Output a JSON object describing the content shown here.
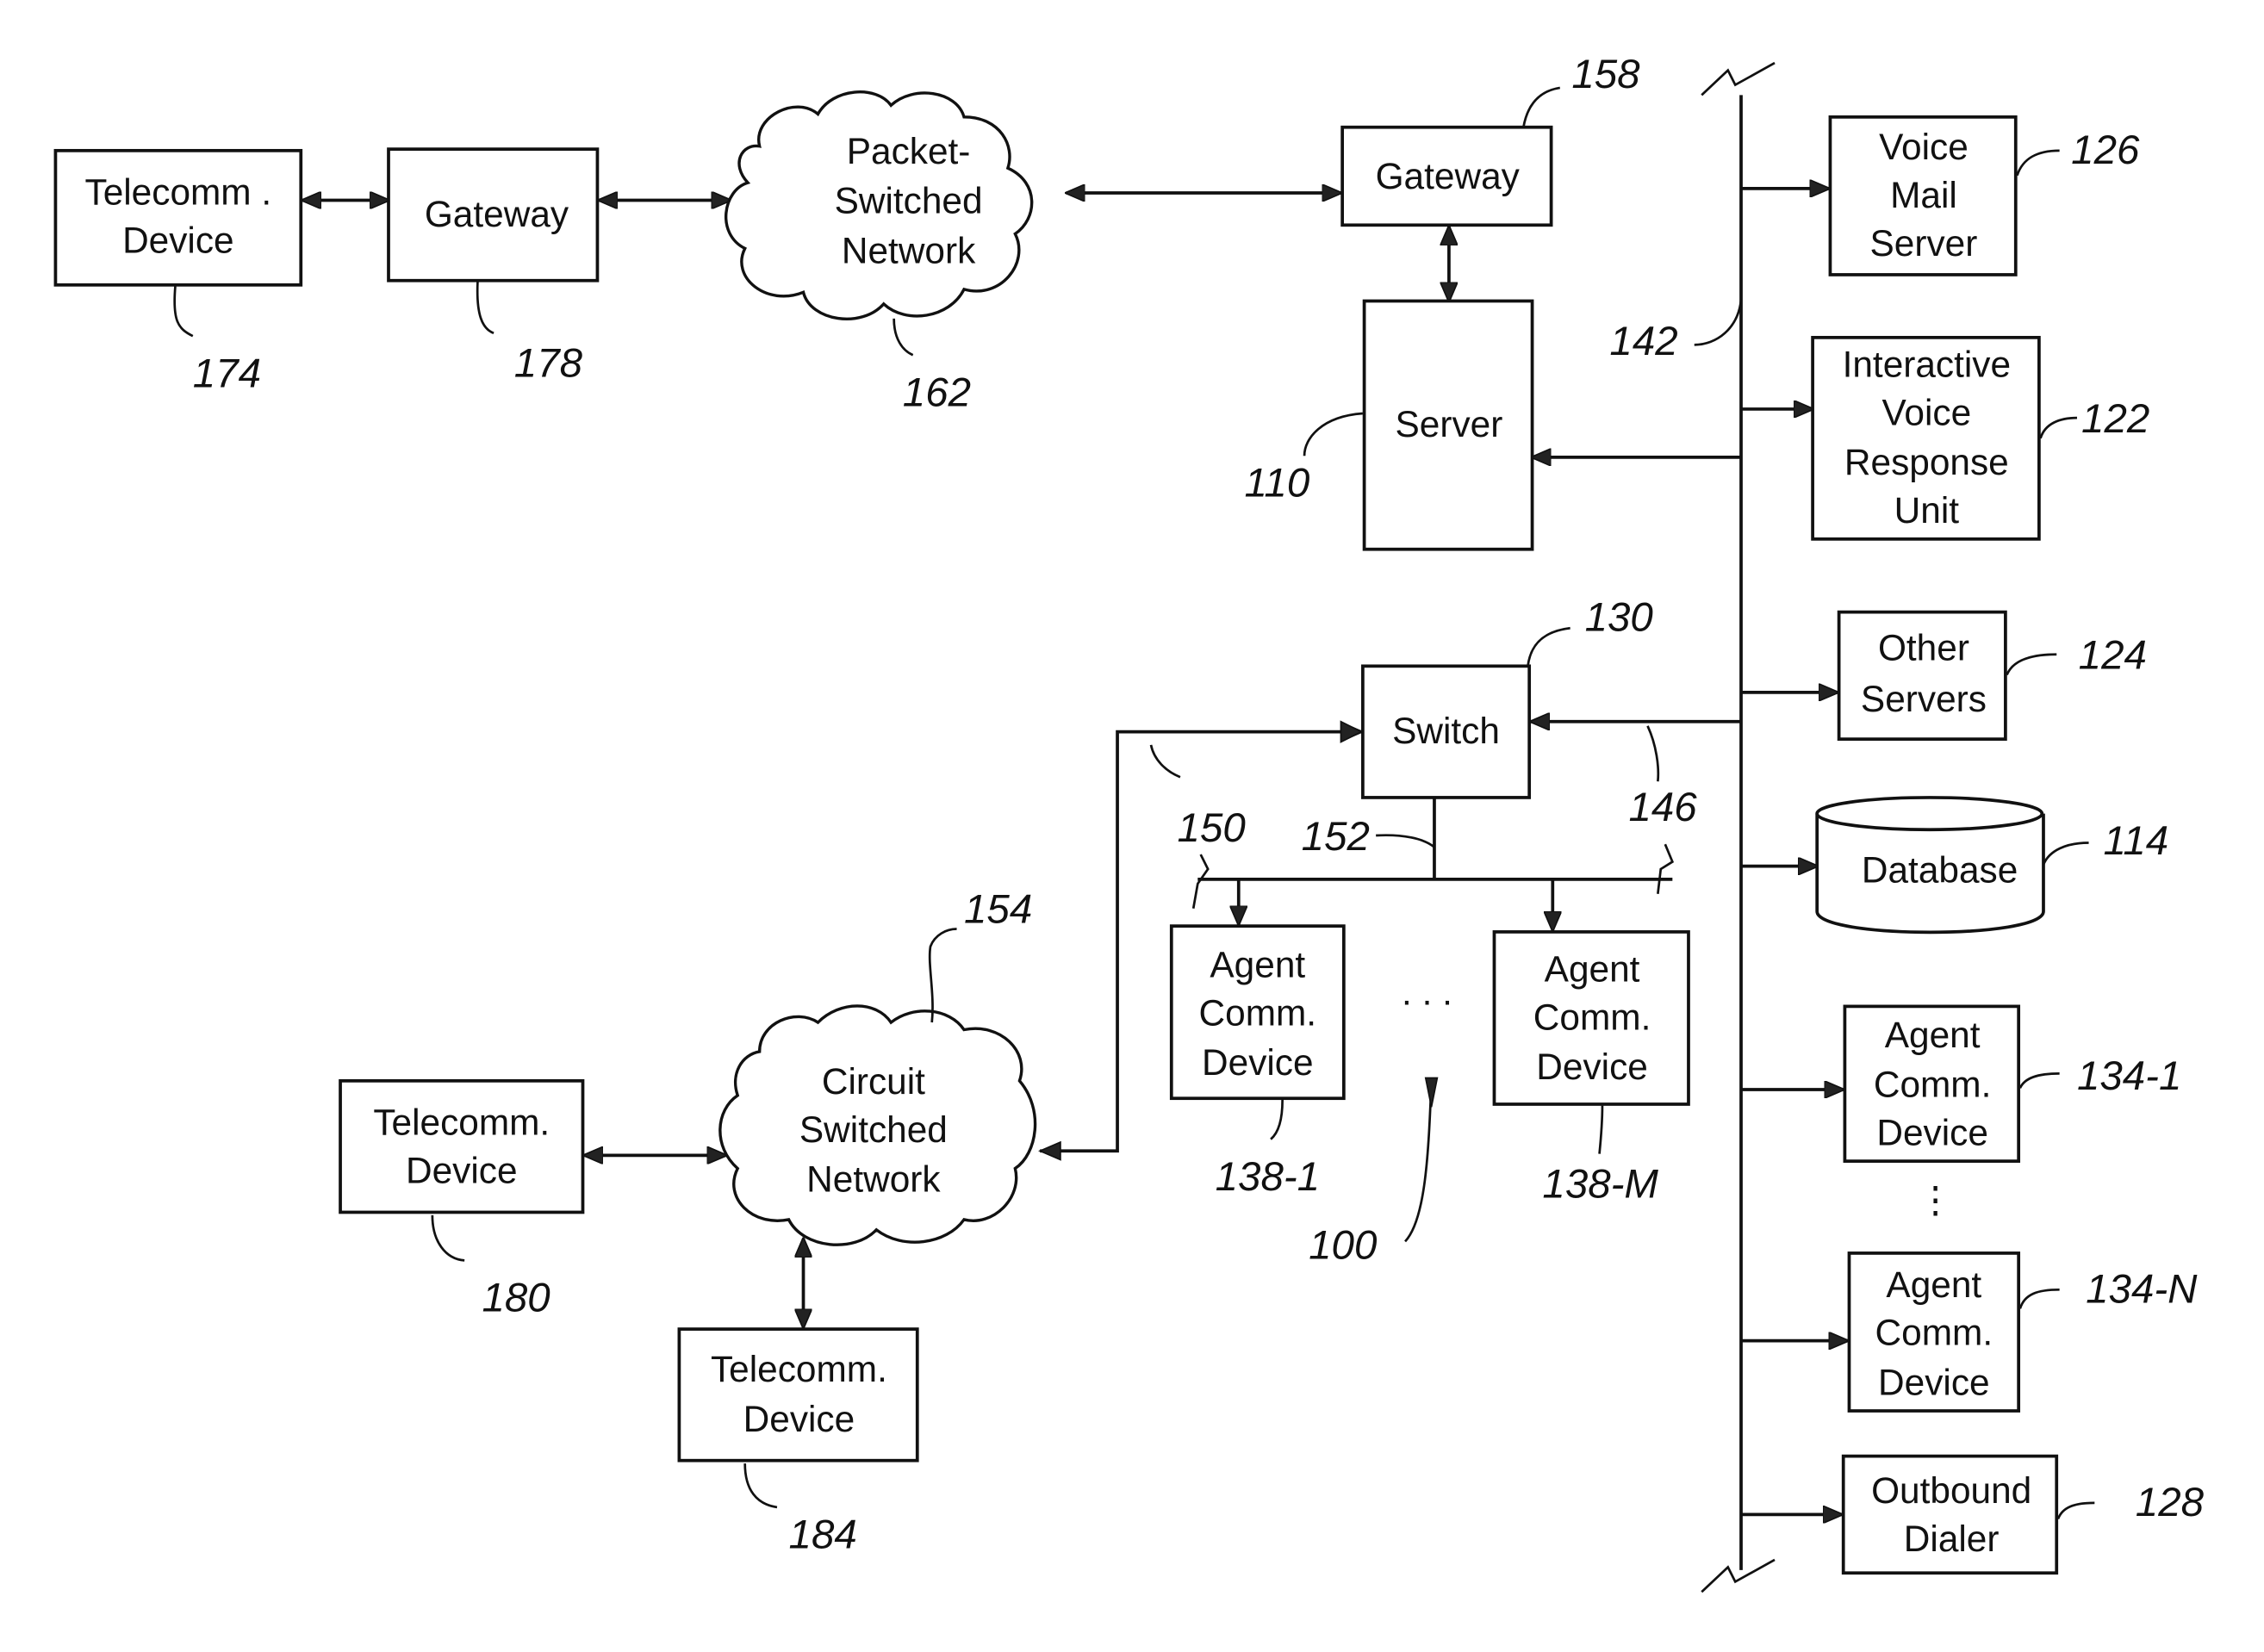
{
  "figure": {
    "nodes": {
      "telecomm_174": {
        "lines": [
          "Telecomm .",
          "Device"
        ],
        "ref": "174"
      },
      "gateway_178": {
        "lines": [
          "Gateway"
        ],
        "ref": "178"
      },
      "psn_162": {
        "lines": [
          "Packet-",
          "Switched",
          "Network"
        ],
        "ref": "162"
      },
      "gateway_158": {
        "lines": [
          "Gateway"
        ],
        "ref": "158"
      },
      "server_110": {
        "lines": [
          "Server"
        ],
        "ref": "110"
      },
      "bus_142": {
        "ref": "142"
      },
      "voicemail_126": {
        "lines": [
          "Voice",
          "Mail",
          "Server"
        ],
        "ref": "126"
      },
      "ivr_122": {
        "lines": [
          "Interactive",
          "Voice",
          "Response",
          "Unit"
        ],
        "ref": "122"
      },
      "switch_130": {
        "lines": [
          "Switch"
        ],
        "ref": "130"
      },
      "other_servers_124": {
        "lines": [
          "Other",
          "Servers"
        ],
        "ref": "124"
      },
      "database_114": {
        "lines": [
          "Database"
        ],
        "ref": "114"
      },
      "link_146": {
        "ref": "146"
      },
      "link_150": {
        "ref": "150"
      },
      "link_152": {
        "ref": "152"
      },
      "csn_154": {
        "lines": [
          "Circuit",
          "Switched",
          "Network"
        ],
        "ref": "154"
      },
      "agent_138_1": {
        "lines": [
          "Agent",
          "Comm.",
          "Device"
        ],
        "ref": "138-1"
      },
      "agent_138_m": {
        "lines": [
          "Agent",
          "Comm.",
          "Device"
        ],
        "ref": "138-M"
      },
      "ellipsis_agents": {
        "text": ". . ."
      },
      "system_100": {
        "ref": "100"
      },
      "agent_134_1": {
        "lines": [
          "Agent",
          "Comm.",
          "Device"
        ],
        "ref": "134-1"
      },
      "vellipsis": {
        "text": "⋮"
      },
      "agent_134_n": {
        "lines": [
          "Agent",
          "Comm.",
          "Device"
        ],
        "ref": "134-N"
      },
      "dialer_128": {
        "lines": [
          "Outbound",
          "Dialer"
        ],
        "ref": "128"
      },
      "telecomm_180": {
        "lines": [
          "Telecomm.",
          "Device"
        ],
        "ref": "180"
      },
      "telecomm_184": {
        "lines": [
          "Telecomm.",
          "Device"
        ],
        "ref": "184"
      }
    }
  }
}
